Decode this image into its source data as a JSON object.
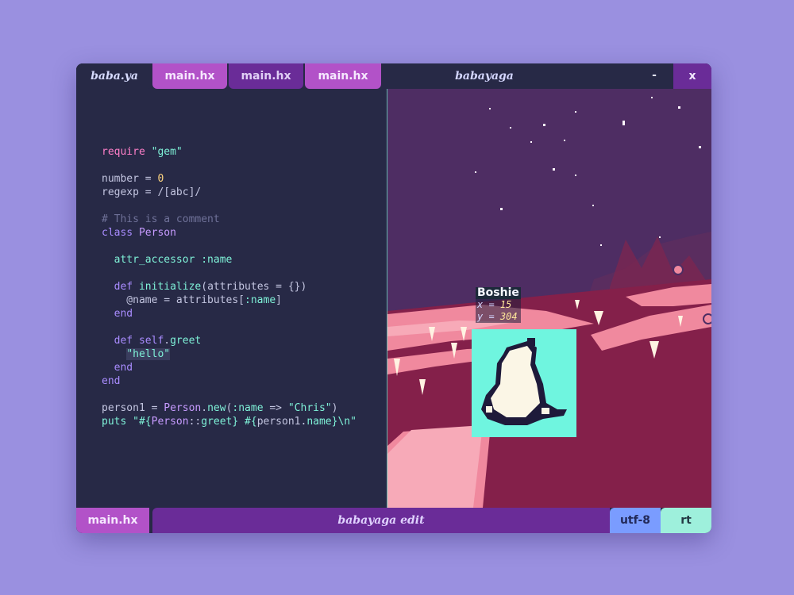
{
  "window": {
    "title": "babayaga",
    "minimize_label": "-",
    "close_label": "x"
  },
  "tabs": {
    "file_label": "baba.ya",
    "items": [
      "main.hx",
      "main.hx",
      "main.hx"
    ]
  },
  "editor": {
    "lines": [
      "require \"gem\"",
      "",
      "number = 0",
      "regexp = /[abc]/",
      "",
      "# This is a comment",
      "class Person",
      "",
      "  attr_accessor :name",
      "",
      "  def initialize(attributes = {})",
      "    @name = attributes[:name]",
      "  end",
      "",
      "  def self.greet",
      "    \"hello\"",
      "  end",
      "end",
      "",
      "person1 = Person.new(:name => \"Chris\")",
      "puts \"#{Person::greet} #{person1.name}\\n\""
    ]
  },
  "game": {
    "sprite_name": "Boshie",
    "x_label": "x = ",
    "x_value": "15",
    "y_label": "y = ",
    "y_value": "304"
  },
  "statusbar": {
    "file": "main.hx",
    "mode_title": "babayaga edit",
    "encoding": "utf-8",
    "mode": "rt"
  },
  "colors": {
    "background": "#9a90e0",
    "panel": "#272946",
    "tab_active": "#b252c8",
    "tab_dark": "#6a2c98",
    "encoding_badge": "#7a9cff",
    "mode_badge": "#9ef0dc",
    "sky": "#4e2d63",
    "ground": "#84204a",
    "sprite_bg": "#6ff5df"
  }
}
